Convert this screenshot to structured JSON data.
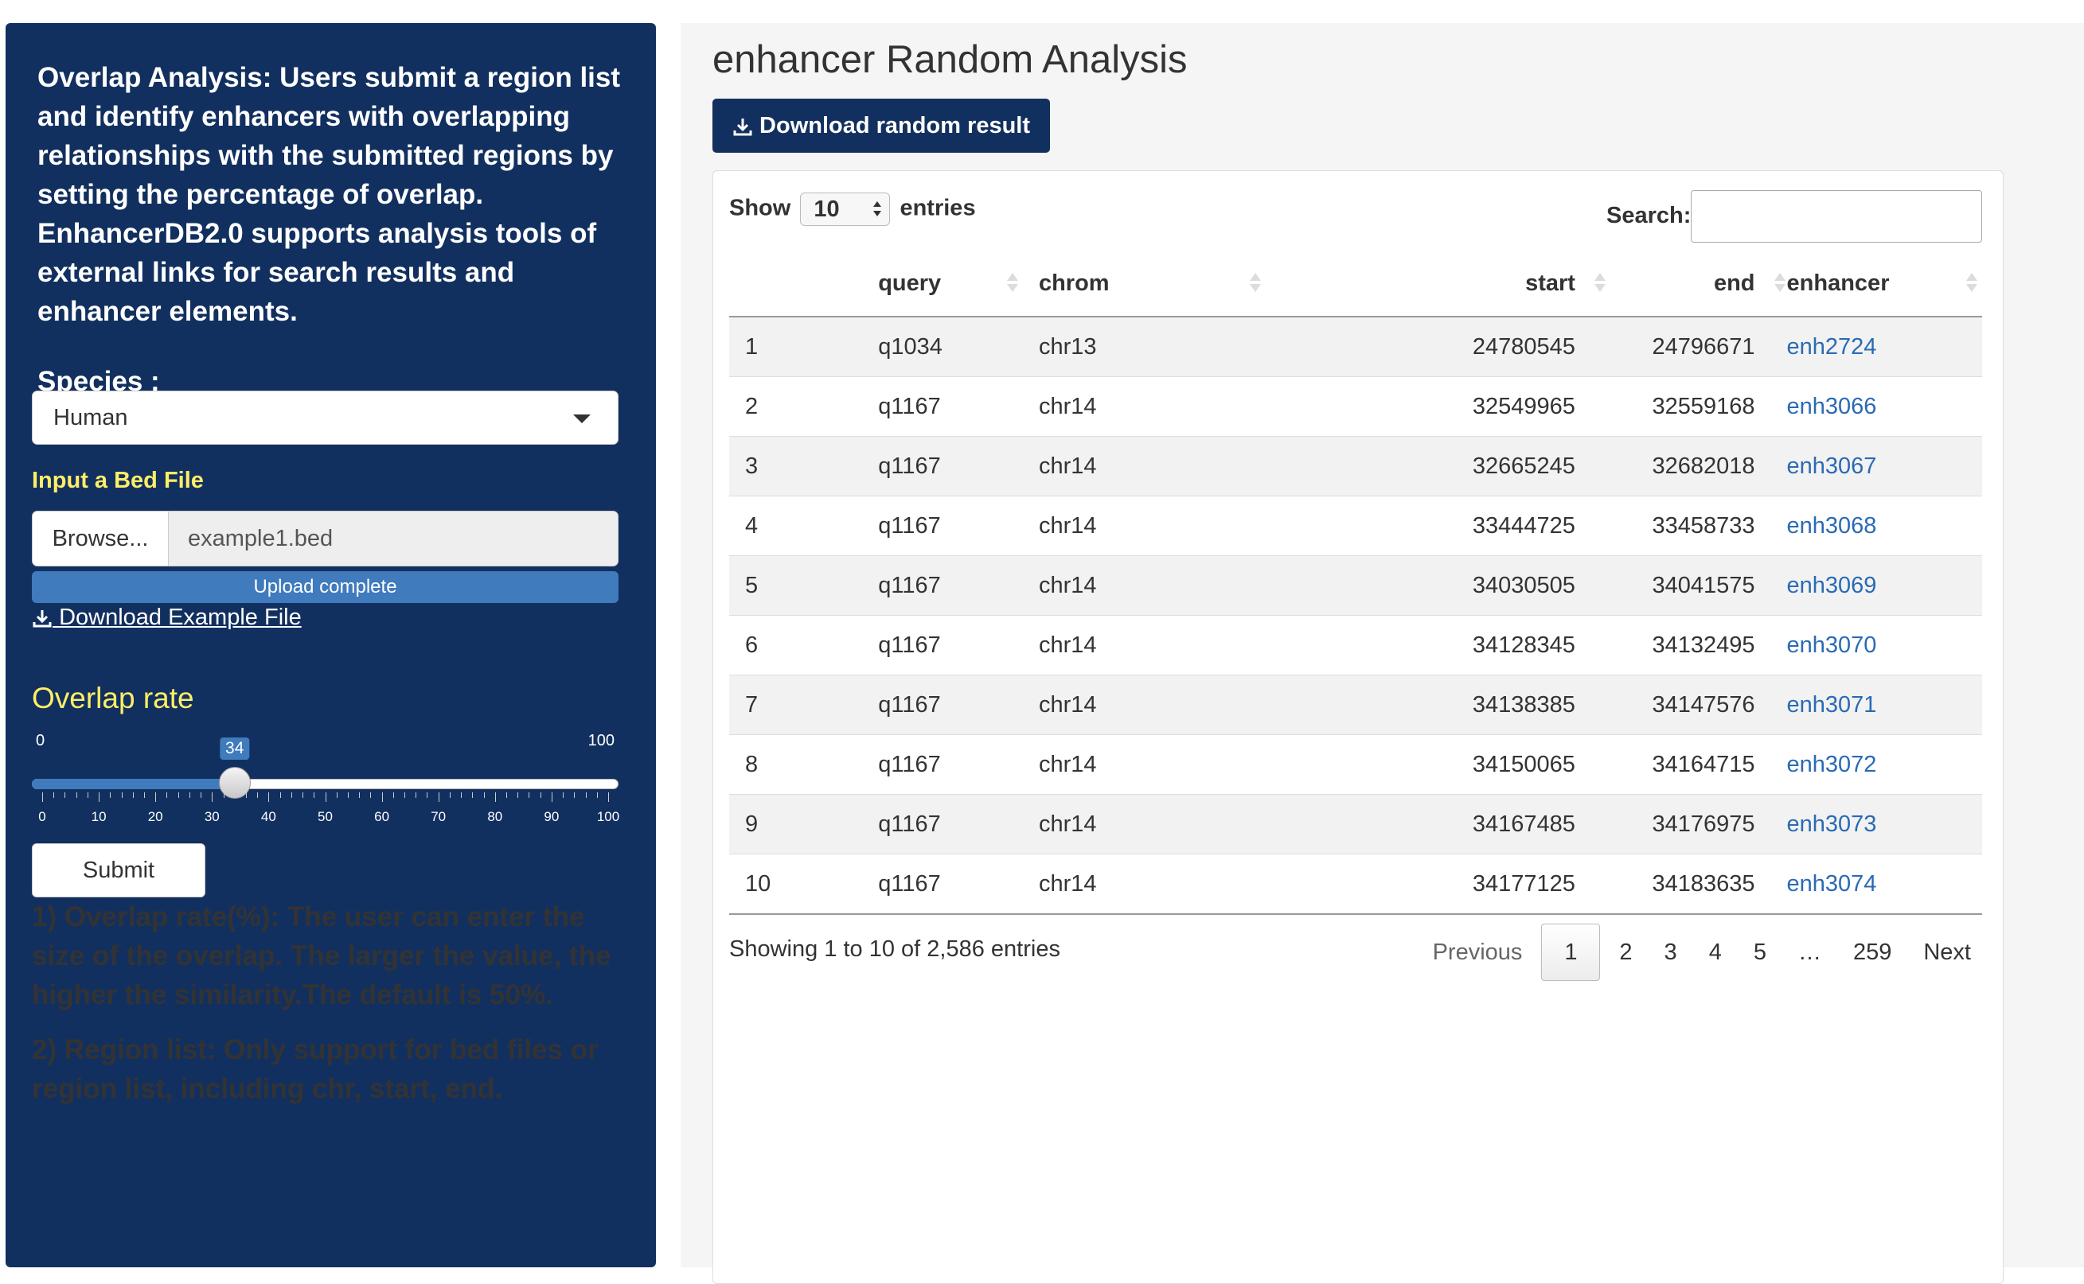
{
  "sidebar": {
    "description": "Overlap Analysis: Users submit a region list and identify enhancers with overlapping relationships with the submitted regions by setting the percentage of overlap. EnhancerDB2.0 supports analysis tools of external links for search results and enhancer elements.",
    "species_label": "Species :",
    "species_value": "Human",
    "file_label": "Input a Bed File",
    "browse_label": "Browse...",
    "file_name": "example1.bed",
    "upload_status": "Upload complete",
    "upload_progress": 1.0,
    "download_example": "Download Example File",
    "overlap_title": "Overlap rate",
    "slider": {
      "min": 0,
      "max": 100,
      "value": 34,
      "min_label": "0",
      "max_label": "100",
      "value_label": "34",
      "tick_labels": [
        "0",
        "10",
        "20",
        "30",
        "40",
        "50",
        "60",
        "70",
        "80",
        "90",
        "100"
      ]
    },
    "submit_label": "Submit",
    "notes": [
      "1) Overlap rate(%): The user can enter the size of the overlap. The larger the value, the higher the similarity.The default is 50%.",
      "2) Region list: Only support for bed files or region list, including chr, start, end."
    ]
  },
  "main": {
    "title": "enhancer Random Analysis",
    "download_button": "Download random result",
    "show_label": "Show",
    "show_value": "10",
    "entries_label": "entries",
    "search_label": "Search:",
    "search_value": "",
    "columns": [
      "",
      "query",
      "chrom",
      "start",
      "end",
      "enhancer"
    ],
    "rows": [
      [
        "1",
        "q1034",
        "chr13",
        "24780545",
        "24796671",
        "enh2724"
      ],
      [
        "2",
        "q1167",
        "chr14",
        "32549965",
        "32559168",
        "enh3066"
      ],
      [
        "3",
        "q1167",
        "chr14",
        "32665245",
        "32682018",
        "enh3067"
      ],
      [
        "4",
        "q1167",
        "chr14",
        "33444725",
        "33458733",
        "enh3068"
      ],
      [
        "5",
        "q1167",
        "chr14",
        "34030505",
        "34041575",
        "enh3069"
      ],
      [
        "6",
        "q1167",
        "chr14",
        "34128345",
        "34132495",
        "enh3070"
      ],
      [
        "7",
        "q1167",
        "chr14",
        "34138385",
        "34147576",
        "enh3071"
      ],
      [
        "8",
        "q1167",
        "chr14",
        "34150065",
        "34164715",
        "enh3072"
      ],
      [
        "9",
        "q1167",
        "chr14",
        "34167485",
        "34176975",
        "enh3073"
      ],
      [
        "10",
        "q1167",
        "chr14",
        "34177125",
        "34183635",
        "enh3074"
      ]
    ],
    "info": "Showing 1 to 10 of 2,586 entries",
    "pagination": {
      "previous": "Previous",
      "pages": [
        "1",
        "2",
        "3",
        "4",
        "5",
        "…",
        "259"
      ],
      "current": "1",
      "next": "Next"
    }
  },
  "colors": {
    "sidebar_bg": "#12305f",
    "accent_yellow": "#ffee66",
    "progress_blue": "#3f7bbd",
    "link_blue": "#2a6ab4"
  }
}
